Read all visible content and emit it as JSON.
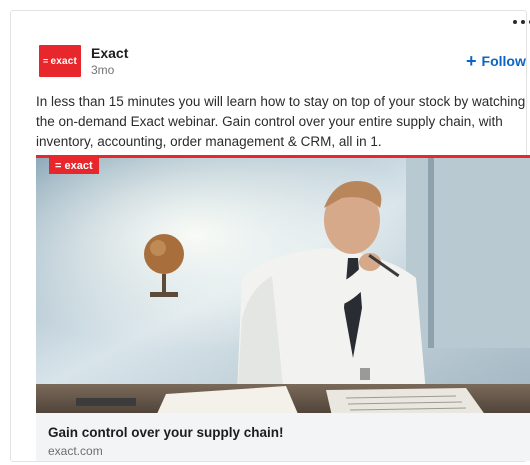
{
  "post": {
    "company_name": "Exact",
    "post_age": "3mo",
    "logo_text": "exact",
    "logo_prefix": "=",
    "follow_label": "Follow",
    "follow_plus": "+",
    "body_text": "In less than 15 minutes you will learn how to stay on top of your stock by watching the on-demand Exact webinar. Gain control over your entire supply chain, with inventory, accounting, order management & CRM, all in 1.",
    "image_badge": "= exact",
    "link_title": "Gain control over your supply chain!",
    "link_domain": "exact.com"
  },
  "colors": {
    "brand_red": "#e8272c",
    "follow_blue": "#0a66c2"
  },
  "icons": {
    "more": "more-options-icon",
    "plus": "plus-icon"
  }
}
